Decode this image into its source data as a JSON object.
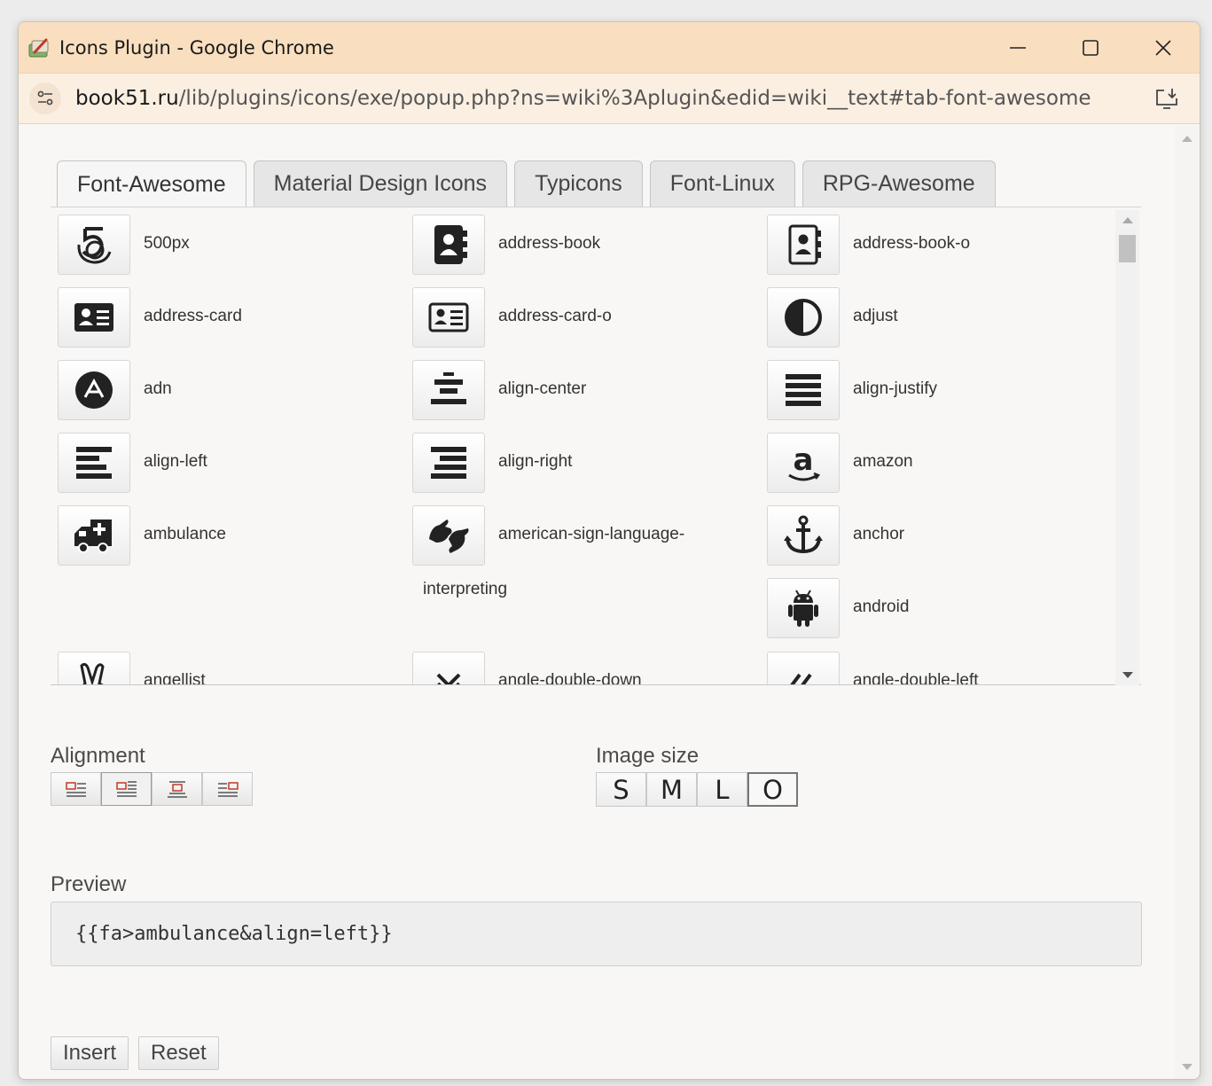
{
  "window": {
    "title": "Icons Plugin - Google Chrome",
    "controls": {
      "minimize": "—",
      "maximize": "☐",
      "close": "✕"
    }
  },
  "address": {
    "host": "book51.ru",
    "path": "/lib/plugins/icons/exe/popup.php?ns=wiki%3Aplugin&edid=wiki__text#tab-font-awesome"
  },
  "tabs": [
    {
      "label": "Font-Awesome",
      "active": true
    },
    {
      "label": "Material Design Icons",
      "active": false
    },
    {
      "label": "Typicons",
      "active": false
    },
    {
      "label": "Font-Linux",
      "active": false
    },
    {
      "label": "RPG-Awesome",
      "active": false
    }
  ],
  "icons": {
    "col1": [
      "500px",
      "address-card",
      "adn",
      "align-left",
      "ambulance",
      "angellist"
    ],
    "col2": [
      "address-book",
      "address-card-o",
      "align-center",
      "align-right",
      "american-sign-language-",
      "angle-double-down"
    ],
    "col2_wrap": "interpreting",
    "col3": [
      "address-book-o",
      "adjust",
      "align-justify",
      "amazon",
      "anchor",
      "android",
      "angle-double-left"
    ]
  },
  "alignment": {
    "label": "Alignment",
    "selected": 1
  },
  "image_size": {
    "label": "Image size",
    "options": [
      "S",
      "M",
      "L",
      "O"
    ],
    "selected": 3
  },
  "preview": {
    "label": "Preview",
    "value": "{{fa>ambulance&align=left}}"
  },
  "actions": {
    "insert": "Insert",
    "reset": "Reset"
  }
}
